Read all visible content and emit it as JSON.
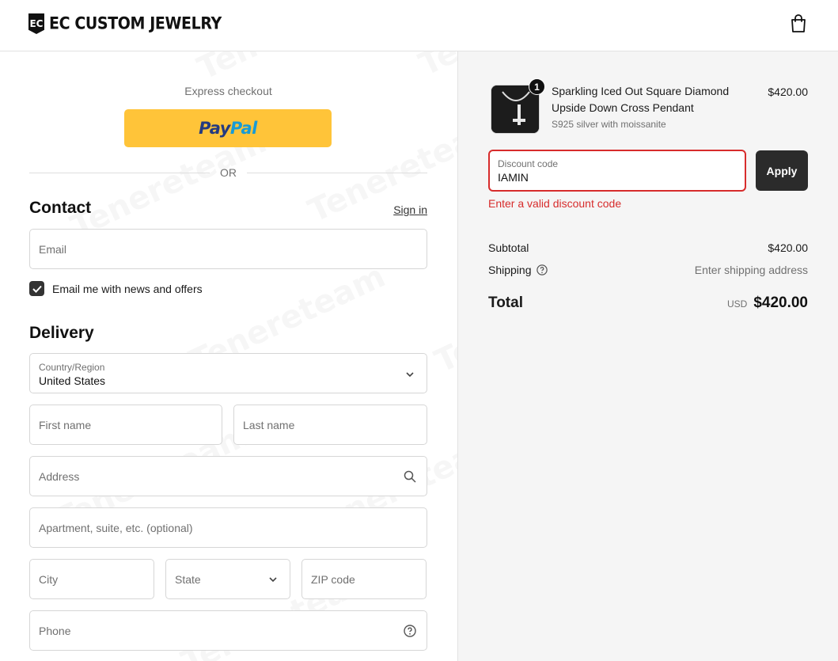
{
  "brand": {
    "logo_mark": "EC",
    "name": "EC CUSTOM JEWELRY"
  },
  "express": {
    "label": "Express checkout",
    "paypal_part1": "Pay",
    "paypal_part2": "Pal"
  },
  "divider": {
    "or_text": "OR"
  },
  "contact": {
    "title": "Contact",
    "sign_in": "Sign in",
    "email_placeholder": "Email",
    "newsletter_label": "Email me with news and offers",
    "newsletter_checked": true
  },
  "delivery": {
    "title": "Delivery",
    "country_label": "Country/Region",
    "country_value": "United States",
    "first_name_placeholder": "First name",
    "last_name_placeholder": "Last name",
    "address_placeholder": "Address",
    "apartment_placeholder": "Apartment, suite, etc. (optional)",
    "city_placeholder": "City",
    "state_placeholder": "State",
    "zip_placeholder": "ZIP code",
    "phone_placeholder": "Phone"
  },
  "summary": {
    "item": {
      "quantity": "1",
      "name": "Sparkling Iced Out Square Diamond Upside Down Cross Pendant",
      "variant": "S925 silver with moissanite",
      "price": "$420.00"
    },
    "discount": {
      "label": "Discount code",
      "value": "IAMIN",
      "apply": "Apply",
      "error": "Enter a valid discount code"
    },
    "subtotal_label": "Subtotal",
    "subtotal_value": "$420.00",
    "shipping_label": "Shipping",
    "shipping_value": "Enter shipping address",
    "total_label": "Total",
    "currency": "USD",
    "total_value": "$420.00"
  },
  "watermark_text": "Tenereteam",
  "colors": {
    "paypal_yellow": "#ffc439",
    "error_red": "#d72c2c",
    "button_dark": "#2b2b2b"
  }
}
